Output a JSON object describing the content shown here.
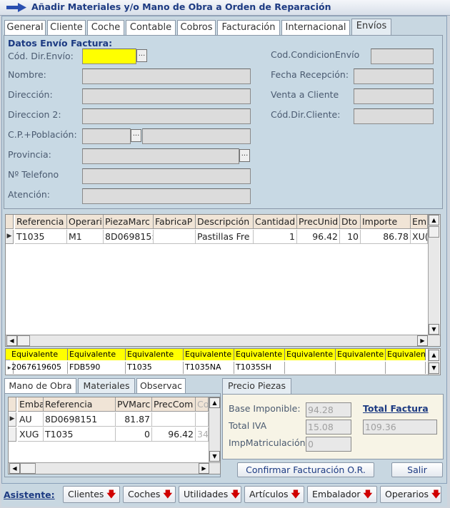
{
  "window": {
    "title": "Añadir Materiales y/o Mano de Obra a Orden de Reparación"
  },
  "tabs": [
    "General",
    "Cliente",
    "Coche",
    "Contable",
    "Cobros",
    "Facturación",
    "Internacional",
    "Envíos"
  ],
  "envio": {
    "section_title": "Datos Envío Factura:",
    "left_labels": [
      "Cód. Dir.Envío:",
      "Nombre:",
      "Dirección:",
      "Direccion 2:",
      "C.P.+Población:",
      "Provincia:",
      "Nº Telefono",
      "Atención:"
    ],
    "right_labels": [
      "Cod.CondicionEnvío",
      "Fecha Recepción:",
      "Venta a Cliente",
      "Cód.Dir.Cliente:"
    ],
    "ellipsis": "..."
  },
  "lines_grid": {
    "headers": [
      "Referencia",
      "Operari",
      "PiezaMarc",
      "FabricaP",
      "Descripción",
      "Cantidad",
      "PrecUnid",
      "Dto",
      "Importe",
      "Em"
    ],
    "row": [
      "T1035",
      "M1",
      "8D069815:",
      "",
      "Pastillas Fre",
      "1",
      "96.42",
      "10",
      "86.78",
      "XU("
    ],
    "row_marker": "▶"
  },
  "equivalents": {
    "header": "Equivalente",
    "values": [
      "2067619605",
      "FDB590",
      "T1035",
      "T1035NA",
      "T1035SH",
      "",
      "",
      ""
    ],
    "marker": "▸"
  },
  "bottom_tabs": [
    "Mano de Obra",
    "Materiales",
    "Observac"
  ],
  "materials_grid": {
    "headers": [
      "Emba",
      "Referencia",
      "PVMarc",
      "PrecCom",
      "Co"
    ],
    "rows": [
      [
        "AU",
        "8D0698151",
        "81.87",
        "",
        ""
      ],
      [
        "XUG",
        "T1035",
        "0",
        "96.42",
        "34"
      ]
    ],
    "row_marker": "▶"
  },
  "precio": {
    "tab": "Precio Piezas",
    "base_label": "Base Imponible:",
    "base_value": "94.28",
    "iva_label": "Total IVA",
    "iva_value": "15.08",
    "matric_label": "ImpMatriculación",
    "matric_value": "0",
    "total_label": "Total Factura",
    "total_value": "109.36"
  },
  "buttons": {
    "confirm": "Confirmar Facturación O.R.",
    "exit": "Salir"
  },
  "assistant": {
    "label": "Asistente:",
    "buttons": [
      "Clientes",
      "Coches",
      "Utilidades",
      "Artículos",
      "Embalador",
      "Operarios"
    ],
    "arrow": "🡇"
  },
  "colors": {
    "accent": "#1c3a82",
    "highlight": "#ffff00",
    "panel": "#c8d9e4",
    "header": "#f0e4d6"
  }
}
